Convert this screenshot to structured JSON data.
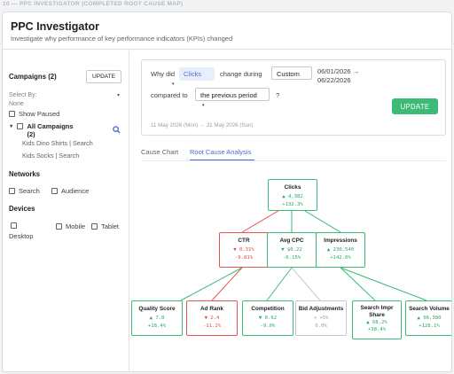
{
  "caption": "10 — PPC INVESTIGATOR (COMPLETED ROOT CAUSE MAP)",
  "header": {
    "title": "PPC Investigator",
    "subtitle": "Investigate why performance of key performance indicators (KPIs) changed"
  },
  "sidebar": {
    "campaigns_heading": "Campaigns (2)",
    "update_label": "UPDATE",
    "select_by_label": "Select By:",
    "select_by_value": "None",
    "show_paused_label": "Show Paused",
    "all_campaigns_label": "All Campaigns",
    "all_campaigns_count": "(2)",
    "campaigns": [
      "Kids Dino Shirts | Search",
      "Kids Socks | Search"
    ],
    "networks_heading": "Networks",
    "networks": [
      "Search",
      "Audience"
    ],
    "devices_heading": "Devices",
    "devices": [
      "Desktop",
      "Mobile",
      "Tablet"
    ]
  },
  "query": {
    "why_did": "Why did",
    "metric": "Clicks",
    "change_during": "change during",
    "range_type": "Custom",
    "date_range_line1": "06/01/2026 →",
    "date_range_line2": "06/22/2026",
    "compared_to": "compared to",
    "comparison": "the previous period",
    "question_mark": "?",
    "update_label": "UPDATE",
    "comparison_dates": "11 May 2026 (Mon) → 31 May 2026 (Sun)"
  },
  "tabs": [
    {
      "label": "Cause Chart",
      "active": false
    },
    {
      "label": "Root Cause Analysis",
      "active": true
    }
  ],
  "tree": {
    "clicks": {
      "name": "Clicks",
      "value": "▲ 4,382",
      "change": "+132.3%",
      "status": "good"
    },
    "ctr": {
      "name": "CTR",
      "value": "▼ 0.31%",
      "change": "-9.81%",
      "status": "bad"
    },
    "avg_cpc": {
      "name": "Avg CPC",
      "value": "▼ $0.22",
      "change": "-6.15%",
      "status": "good"
    },
    "impressions": {
      "name": "Impressions",
      "value": "▲ 230,540",
      "change": "+142.6%",
      "status": "good"
    },
    "quality_score": {
      "name": "Quality Score",
      "value": "▲ 7.8",
      "change": "+18.4%",
      "status": "good"
    },
    "ad_rank": {
      "name": "Ad Rank",
      "value": "▼ 2.4",
      "change": "-11.2%",
      "status": "bad"
    },
    "competition": {
      "name": "Competition",
      "value": "▼ 0.62",
      "change": "-9.0%",
      "status": "good"
    },
    "bid_adjustments": {
      "name": "Bid Adjustments",
      "value": "+ +5%",
      "change": "0.0%",
      "status": "neutral"
    },
    "search_impr_share": {
      "name": "Search Impr Share",
      "value": "▲ 68.2%",
      "change": "+38.4%",
      "status": "good"
    },
    "search_volume": {
      "name": "Search Volume",
      "value": "▲ 96,380",
      "change": "+128.1%",
      "status": "good"
    }
  },
  "colors": {
    "good": "#3dba76",
    "bad": "#e8554e",
    "neutral": "#c6c9cc",
    "accent": "#4a6cd4"
  }
}
